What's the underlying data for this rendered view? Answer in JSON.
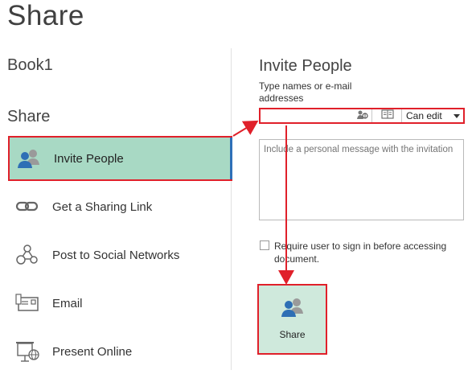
{
  "header": {
    "title": "Share"
  },
  "workbook": {
    "name": "Book1"
  },
  "nav": {
    "section_title": "Share",
    "items": [
      {
        "label": "Invite People",
        "icon": "invite-people-icon",
        "active": true
      },
      {
        "label": "Get a Sharing Link",
        "icon": "link-icon"
      },
      {
        "label": "Post to Social Networks",
        "icon": "social-network-icon"
      },
      {
        "label": "Email",
        "icon": "email-icon"
      },
      {
        "label": "Present Online",
        "icon": "present-online-icon"
      }
    ]
  },
  "invite": {
    "heading": "Invite People",
    "recipients_label": "Type names or e-mail addresses",
    "recipients_value": "",
    "permission": "Can edit",
    "message_placeholder": "Include a personal message with the invitation",
    "require_signin_label": "Require user to sign in before accessing document.",
    "require_signin_checked": false,
    "share_button_label": "Share"
  },
  "colors": {
    "accent_green": "#a8d9c4",
    "share_button_bg": "#cfe9dc",
    "highlight_red": "#e0202a",
    "active_bar_blue": "#2e70b8"
  }
}
